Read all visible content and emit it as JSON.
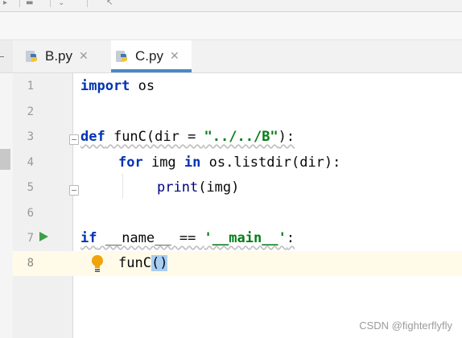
{
  "tabs": [
    {
      "label": "B.py",
      "active": false
    },
    {
      "label": "C.py",
      "active": true
    }
  ],
  "line_numbers": [
    "1",
    "2",
    "3",
    "4",
    "5",
    "6",
    "7",
    "8"
  ],
  "code": {
    "line1": {
      "kw": "import",
      "rest": " os"
    },
    "line3": {
      "kw": "def",
      "name": " funC(dir = ",
      "str": "\"../../B\"",
      "end": "):"
    },
    "line4": {
      "kw_for": "for",
      "mid": " img ",
      "kw_in": "in",
      "rest": " os.listdir(dir):"
    },
    "line5": {
      "builtin": "print",
      "rest": "(img)"
    },
    "line7": {
      "kw": "if",
      "mid": " __name__ == ",
      "str": "'__main__'",
      "end": ":"
    },
    "line8": {
      "call": "funC",
      "paren": "()"
    }
  },
  "watermark": "CSDN @fighterflyfly",
  "colors": {
    "keyword": "#0033b3",
    "string": "#067d17",
    "accent": "#4a88c7",
    "run": "#3b9f45"
  }
}
